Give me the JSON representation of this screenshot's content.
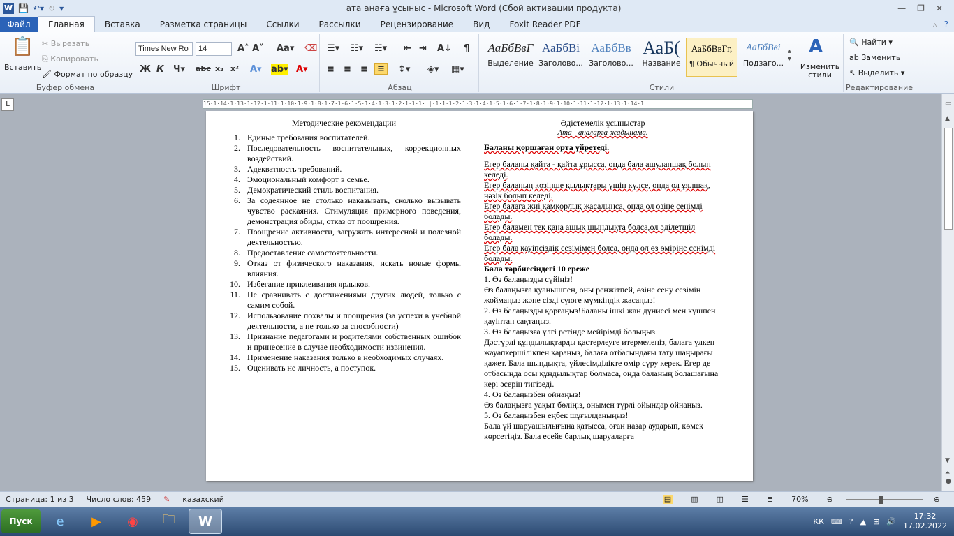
{
  "titlebar": {
    "title": "ата анаға ұсыныс  -  Microsoft Word (Сбой активации продукта)"
  },
  "tabs": [
    "Файл",
    "Главная",
    "Вставка",
    "Разметка страницы",
    "Ссылки",
    "Рассылки",
    "Рецензирование",
    "Вид",
    "Foxit Reader PDF"
  ],
  "clipboard": {
    "paste": "Вставить",
    "cut": "Вырезать",
    "copy": "Копировать",
    "format": "Формат по образцу",
    "label": "Буфер обмена"
  },
  "font": {
    "name": "Times New Ro",
    "size": "14",
    "label": "Шрифт"
  },
  "paragraph": {
    "label": "Абзац"
  },
  "styles": {
    "label": "Стили",
    "change": "Изменить стили",
    "items": [
      {
        "sample": "АаБбВвГ",
        "name": "Выделение"
      },
      {
        "sample": "АаБбВі",
        "name": "Заголово..."
      },
      {
        "sample": "АаБбВв",
        "name": "Заголово..."
      },
      {
        "sample": "АаБ(",
        "name": "Название"
      },
      {
        "sample": "АаБбВвГг,",
        "name": "¶ Обычный"
      },
      {
        "sample": "АаБбВві",
        "name": "Подзаго..."
      }
    ]
  },
  "editing": {
    "find": "Найти",
    "replace": "Заменить",
    "select": "Выделить",
    "label": "Редактирование"
  },
  "ruler": "15·1·14·1·13·1·12·1·11·1·10·1·9·1·8·1·7·1·6·1·5·1·4·1·3·1·2·1·1·1· |·1·1·1·2·1·3·1·4·1·5·1·6·1·7·1·8·1·9·1·10·1·11·1·12·1·13·1·14·1",
  "doc": {
    "left_title": "Методические рекомендации",
    "left_list": [
      {
        "n": "1.",
        "t": "Единые требования воспитателей."
      },
      {
        "n": "2.",
        "t": "Последовательность воспитательных, коррекционных воздействий."
      },
      {
        "n": "3.",
        "t": "Адекватность требований."
      },
      {
        "n": "4.",
        "t": "Эмоциональный комфорт в семье."
      },
      {
        "n": "5.",
        "t": "Демократический стиль воспитания."
      },
      {
        "n": "6.",
        "t": "За содеянное не столько наказывать, сколько вызывать чувство раскаяния. Стимуляция примерного поведения, демонстрация обиды, отказ от поощрения."
      },
      {
        "n": "7.",
        "t": "Поощрение активности, загружать интересной и полезной деятельностью."
      },
      {
        "n": "8.",
        "t": "Предоставление самостоятельности."
      },
      {
        "n": "9.",
        "t": "Отказ от физического наказания, искать новые формы влияния."
      },
      {
        "n": "10.",
        "t": "Избегание приклеивания ярлыков."
      },
      {
        "n": "11.",
        "t": "Не сравнивать с достижениями других людей, только с самим собой."
      },
      {
        "n": "12.",
        "t": "Использование похвалы и поощрения (за успехи в учебной деятельности, а не только за способности)"
      },
      {
        "n": "13.",
        "t": "Признание педагогами и родителями собственных ошибок и принесение в случае необходимости извинения."
      },
      {
        "n": "14.",
        "t": "Применение наказания только в необходимых случаях."
      },
      {
        "n": "15.",
        "t": "Оценивать не личность, а поступок."
      }
    ],
    "right_title": "Әдістемелік ұсыныстар",
    "right_subtitle": "Ата - аналарға жадынама.",
    "right_heading": "Баланы қоршаған орта үйретеді.",
    "right_paras": [
      "Егер баланы қайта - қайта ұрысса, онда бала ашуланшақ болып келеді.",
      "Егер баланың көзінше қылықтары үшін күлсе, онда ол ұялшақ, нәзік болып келеді.",
      "Егер балаға жиі қамқорлық жасалынса, онда ол өзіне сенімді болады.",
      "Егер баламен тек қана ашық шындықта болса,ол әділетшіл болады.",
      "Егер бала қауіпсіздік сезімімен болса, онда ол өз өміріне сенімді болады."
    ],
    "right_heading2": "Бала тәрбиесіндегі 10 ереже",
    "right_lines": [
      "1. Өз балаңызды сүйіңіз!",
      "Өз балаңызға қуанышпен, оны ренжітпей, өзіне сену сезімін жоймаңыз және сізді сүюге мүмкіндік  жасаңыз!",
      "2. Өз балаңызды қорғаңыз!Баланы ішкі жан дүниесі мен күшпен қауіптан сақтаңыз.",
      "3. Өз балаңызға үлгі ретінде мейірімді болыңыз.",
      "Дәстүрлі құндылықтарды қастерлеуге итермелеңіз, балаға үлкен жауапкершілікпен қараңыз, балаға отбасындағы тату шаңырағы қажет. Бала шындықта, үйлесімділікте өмір сүру керек. Егер де отбасында осы құндылықтар болмаса, онда баланың болашағына кері әсерін тигізеді.",
      "4. Өз балаңызбен ойнаңыз!",
      "Өз балаңызға уақыт бөліңіз, онымен түрлі ойындар ойнаңыз.",
      "5. Өз балаңызбен еңбек шұғылданыңыз!",
      "Бала үй шаруашылығына қатысса, оған назар аударып, көмек көрсетіңіз. Бала есейе барлық шаруаларға"
    ]
  },
  "status": {
    "page": "Страница: 1 из 3",
    "words": "Число слов: 459",
    "lang": "казахский",
    "zoom": "70%"
  },
  "taskbar": {
    "start": "Пуск",
    "lang": "КК",
    "time": "17:32",
    "date": "17.02.2022"
  }
}
